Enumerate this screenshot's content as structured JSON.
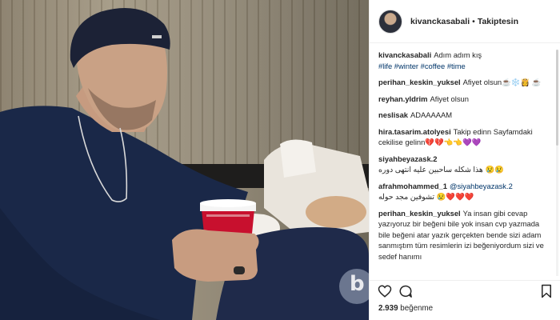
{
  "post": {
    "username": "kivanckasabali",
    "separator": "•",
    "follow_status": "Takiptesin"
  },
  "caption": {
    "username": "kivanckasabali",
    "text": "Adım adım kış",
    "hashtags": "#life #winter #coffee #time"
  },
  "comments": [
    {
      "username": "perihan_keskin_yuksel",
      "text": "Afiyet olsun",
      "emoji": "☕️❄️👸 ☕️"
    },
    {
      "username": "reyhan.yldrim",
      "text": "Afiyet olsun"
    },
    {
      "username": "neslisak",
      "text": "ADAAAAAM"
    },
    {
      "username": "hira.tasarim.atolyesi",
      "text": "Takip edinn Sayfamdaki cekilise gelinn",
      "emoji": "💔💔👈👈💜💜"
    },
    {
      "username": "siyahbeyazask.2",
      "text": "هذا شكله ساحبين عليه انتهى دوره",
      "emoji": "😢😢"
    },
    {
      "username": "afrahmohammed_1",
      "mention": "@siyahbeyazask.2",
      "text": "تشوفين مجد حوله",
      "emoji": "😢❤️❤️❤️"
    },
    {
      "username": "perihan_keskin_yuksel",
      "text": "Ya insan gibi cevap yazıyoruz bir beğeni bile yok insan cvp yazmada bile beğeni atar yazık gerçekten bende sizi adam sanmıştım tüm resimlerin izi beğeniyordum sizi ve sedef hanımı"
    }
  ],
  "likes": {
    "count": "2.939",
    "label": "beğenme"
  },
  "icons": {
    "like": "heart-icon",
    "comment": "comment-icon",
    "save": "bookmark-icon",
    "watermark": "b"
  }
}
